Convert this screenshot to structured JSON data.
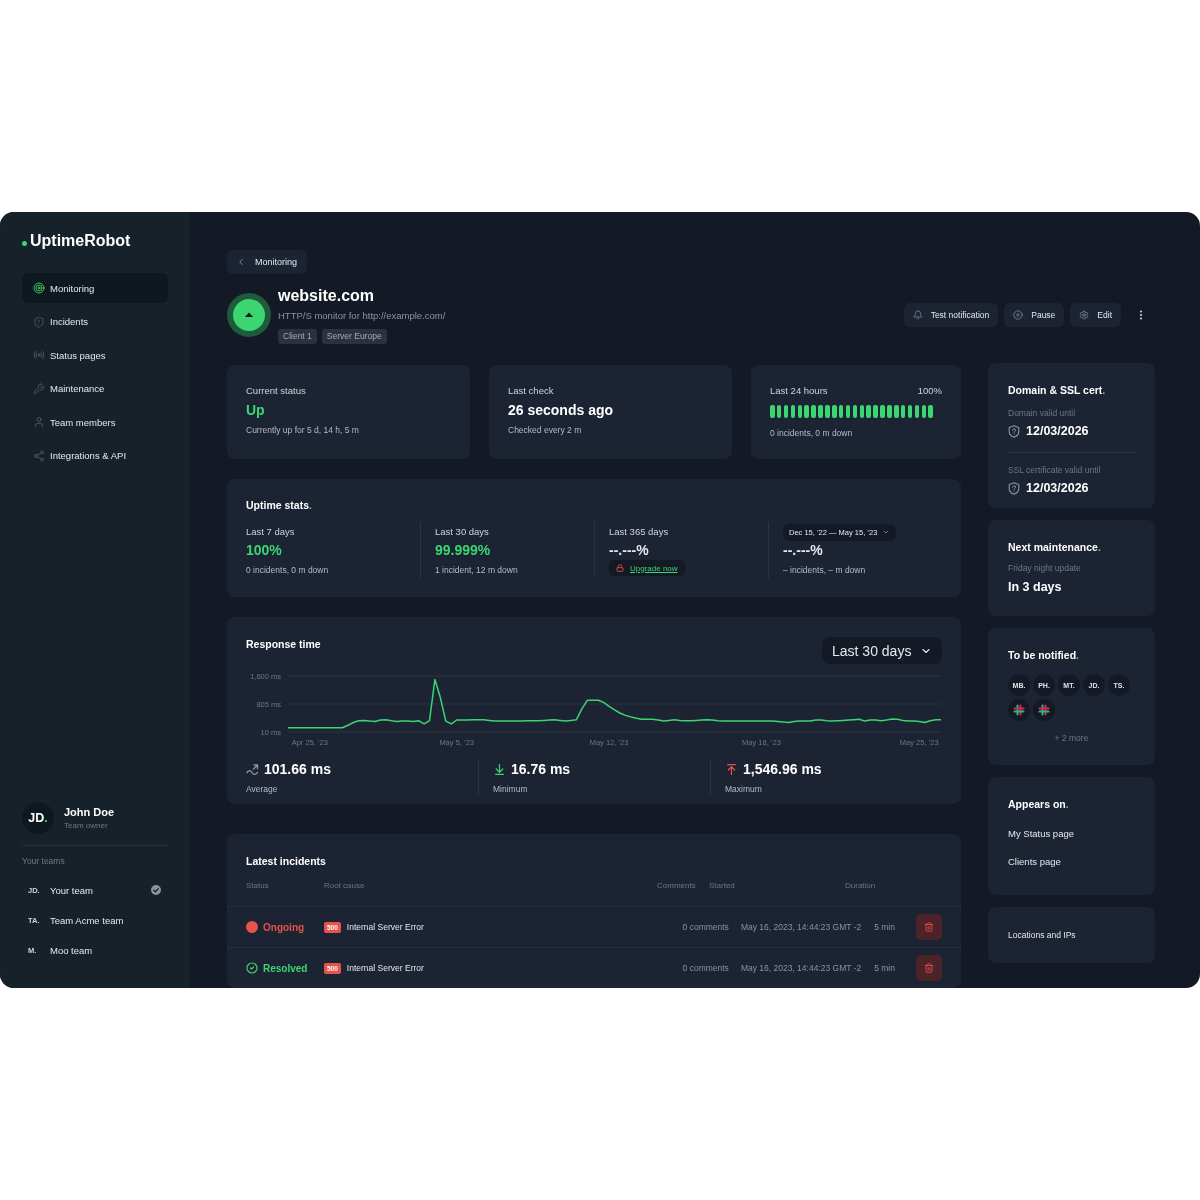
{
  "sidebar": {
    "logo": "UptimeRobot",
    "nav": [
      {
        "label": "Monitoring",
        "selected": true
      },
      {
        "label": "Incidents",
        "selected": false
      },
      {
        "label": "Status pages",
        "selected": false
      },
      {
        "label": "Maintenance",
        "selected": false
      },
      {
        "label": "Team members",
        "selected": false
      },
      {
        "label": "Integrations & API",
        "selected": false
      }
    ],
    "user": {
      "initials": "JD.",
      "name": "John Doe",
      "role": "Team owner"
    },
    "teams_label": "Your teams",
    "teams": [
      {
        "initials": "JD.",
        "name": "Your team",
        "selected": true
      },
      {
        "initials": "TA.",
        "name": "Team Acme team",
        "selected": false
      },
      {
        "initials": "M.",
        "name": "Moo team",
        "selected": false
      }
    ]
  },
  "breadcrumb": {
    "label": "Monitoring"
  },
  "monitor": {
    "name": "website.com",
    "up": true,
    "description": "HTTP/S monitor for http://example.com/",
    "tags": [
      "Client 1",
      "Server Europe"
    ]
  },
  "actions": [
    {
      "label": "Test notification"
    },
    {
      "label": "Pause"
    },
    {
      "label": "Edit"
    }
  ],
  "current_status": {
    "label": "Current status",
    "value": "Up",
    "up": true,
    "detail": "Currently up for 5 d, 14 h, 5 m"
  },
  "last_check": {
    "label": "Last check",
    "value": "26 seconds ago",
    "detail": "Checked every 2 m"
  },
  "last_24h": {
    "label": "Last 24 hours",
    "percent": "100%",
    "bars": [
      {
        "up": true
      },
      {
        "up": true
      },
      {
        "up": true
      },
      {
        "up": true
      },
      {
        "up": true
      },
      {
        "up": true
      },
      {
        "up": true
      },
      {
        "up": true
      },
      {
        "up": true
      },
      {
        "up": true
      },
      {
        "up": true
      },
      {
        "up": true
      },
      {
        "up": true
      },
      {
        "up": true
      },
      {
        "up": true
      },
      {
        "up": true
      },
      {
        "up": true
      },
      {
        "up": true
      },
      {
        "up": true
      },
      {
        "up": true
      },
      {
        "up": true
      },
      {
        "up": true
      },
      {
        "up": true
      },
      {
        "up": true
      }
    ],
    "detail": "0 incidents, 0 m down"
  },
  "uptime_stats": {
    "title": "Uptime stats.",
    "periods": [
      {
        "kind": "plain",
        "label": "Last 7 days",
        "value": "100%",
        "up": true,
        "detail": "0 incidents, 0 m down"
      },
      {
        "kind": "plain",
        "label": "Last 30 days",
        "value": "99.999%",
        "up": true,
        "detail": "1 incident, 12 m down"
      },
      {
        "kind": "locked",
        "label": "Last 365 days",
        "value": "--.---%",
        "up": false,
        "link": "Upgrade now"
      },
      {
        "kind": "range",
        "range": "Dec 15, ’22 — May 15, ’23",
        "value": "--.---%",
        "up": false,
        "detail": "– incidents, – m down"
      }
    ]
  },
  "response_time": {
    "title": "Response time",
    "range": "Last 30 days",
    "chart_data": {
      "type": "line",
      "categories": [
        null,
        null,
        null,
        null,
        "Apr 25, ’23",
        null,
        null,
        null,
        null,
        null,
        null,
        null,
        null,
        null,
        null,
        null,
        null,
        null,
        null,
        null,
        null,
        null,
        null,
        null,
        null,
        null,
        null,
        null,
        null,
        null,
        null,
        "May 5, ’23",
        null,
        null,
        null,
        null,
        null,
        null,
        null,
        null,
        null,
        null,
        null,
        null,
        null,
        null,
        null,
        null,
        null,
        null,
        null,
        null,
        null,
        null,
        null,
        null,
        null,
        null,
        null,
        "May 12, ’23",
        null,
        null,
        null,
        null,
        null,
        null,
        null,
        null,
        null,
        null,
        null,
        null,
        null,
        null,
        null,
        null,
        null,
        null,
        null,
        null,
        null,
        null,
        null,
        null,
        null,
        null,
        null,
        "May 18, ’23",
        null,
        null,
        null,
        null,
        null,
        null,
        null,
        null,
        null,
        null,
        null,
        null,
        null,
        null,
        null,
        null,
        null,
        null,
        null,
        null,
        null,
        null,
        null,
        null,
        null,
        null,
        null,
        null,
        "May 25, ’23",
        null,
        null,
        null,
        null
      ],
      "series": [
        {
          "color": "#3bd671",
          "values": [
            130,
            130,
            130,
            130,
            130,
            130,
            130,
            130,
            130,
            130,
            130,
            200,
            280,
            330,
            340,
            320,
            310,
            350,
            360,
            330,
            310,
            320,
            320,
            310,
            330,
            240,
            330,
            1500,
            980,
            320,
            240,
            350,
            350,
            350,
            360,
            360,
            360,
            340,
            320,
            320,
            320,
            320,
            320,
            320,
            330,
            330,
            330,
            340,
            350,
            360,
            340,
            320,
            340,
            360,
            670,
            910,
            910,
            910,
            850,
            740,
            640,
            550,
            480,
            440,
            400,
            370,
            370,
            370,
            350,
            320,
            340,
            360,
            340,
            330,
            330,
            340,
            350,
            360,
            350,
            330,
            320,
            320,
            320,
            320,
            320,
            320,
            320,
            320,
            320,
            320,
            310,
            290,
            280,
            310,
            320,
            320,
            320,
            350,
            350,
            330,
            320,
            330,
            340,
            350,
            360,
            370,
            320,
            350,
            350,
            330,
            350,
            380,
            370,
            340,
            320,
            320,
            310,
            280,
            330,
            360,
            360
          ]
        }
      ],
      "ylim": [
        10,
        1600
      ],
      "yticks": [
        {
          "value": 1600,
          "label": "1,600 ms"
        },
        {
          "value": 805,
          "label": "805 ms"
        },
        {
          "value": 10,
          "label": "10 ms"
        }
      ]
    },
    "stats": [
      {
        "kind": "average",
        "value": "101.66 ms",
        "label": "Average"
      },
      {
        "kind": "minimum",
        "value": "16.76 ms",
        "label": "Minimum"
      },
      {
        "kind": "maximum",
        "value": "1,546.96 ms",
        "label": "Maximum"
      }
    ]
  },
  "incidents": {
    "title": "Latest incidents",
    "columns": [
      "Status",
      "Root cause",
      "Comments",
      "Started",
      "Duration"
    ],
    "rows": [
      {
        "resolved": false,
        "status_label": "Ongoing",
        "code": "500",
        "root_cause": "Internal Server Error",
        "comments": "0 comments",
        "started": "May 16, 2023, 14:44:23 GMT -2",
        "duration": "5 min"
      },
      {
        "resolved": true,
        "status_label": "Resolved",
        "code": "500",
        "root_cause": "Internal Server Error",
        "comments": "0 comments",
        "started": "May 16, 2023, 14:44:23 GMT -2",
        "duration": "5 min"
      }
    ]
  },
  "domain_ssl": {
    "title": "Domain & SSL cert.",
    "items": [
      {
        "label": "Domain valid until",
        "date": "12/03/2026"
      },
      {
        "label": "SSL certificate valid until",
        "date": "12/03/2026"
      }
    ]
  },
  "next_maintenance": {
    "title": "Next maintenance.",
    "name": "Friday night update",
    "when": "In 3 days"
  },
  "notified": {
    "title": "To be notified.",
    "contacts": [
      {
        "kind": "person",
        "initials": "MB."
      },
      {
        "kind": "person",
        "initials": "PH."
      },
      {
        "kind": "person",
        "initials": "MT."
      },
      {
        "kind": "person",
        "initials": "JD."
      },
      {
        "kind": "person",
        "initials": "TS."
      },
      {
        "kind": "integration"
      },
      {
        "kind": "integration"
      }
    ],
    "more": "+ 2 more"
  },
  "appears_on": {
    "title": "Appears on.",
    "pages": [
      "My Status page",
      "Clients page"
    ]
  },
  "locations": {
    "label": "Locations and IPs"
  }
}
